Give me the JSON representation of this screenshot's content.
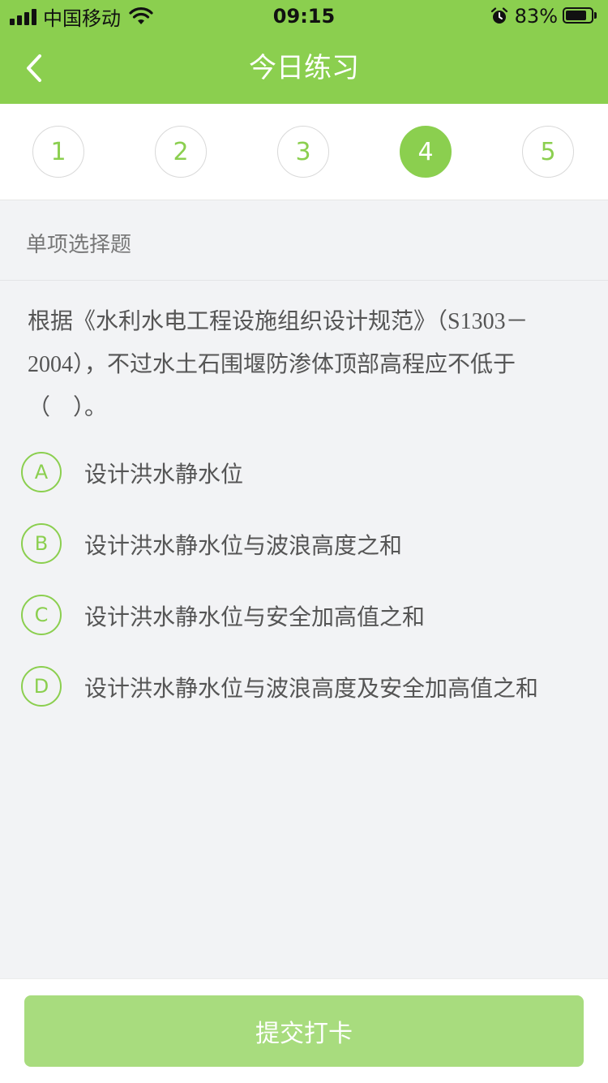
{
  "status_bar": {
    "carrier": "中国移动",
    "time": "09:15",
    "battery_percent": "83%",
    "battery_level": 0.83,
    "signal_bars": 4
  },
  "nav": {
    "title": "今日练习",
    "back_icon": "chevron-left-icon"
  },
  "question_numbers": {
    "items": [
      "1",
      "2",
      "3",
      "4",
      "5"
    ],
    "active_index": 3
  },
  "question": {
    "type": "单项选择题",
    "text": "根据《水利水电工程设施组织设计规范》（S1303－2004），不过水土石围堰防渗体顶部高程应不低于（　）。",
    "options": [
      {
        "letter": "A",
        "text": "设计洪水静水位"
      },
      {
        "letter": "B",
        "text": "设计洪水静水位与波浪高度之和"
      },
      {
        "letter": "C",
        "text": "设计洪水静水位与安全加高值之和"
      },
      {
        "letter": "D",
        "text": "设计洪水静水位与波浪高度及安全加高值之和"
      }
    ]
  },
  "footer": {
    "submit_label": "提交打卡"
  },
  "colors": {
    "accent": "#8bcf4f",
    "button_disabled": "#a8dc7e",
    "background": "#f2f3f5"
  }
}
